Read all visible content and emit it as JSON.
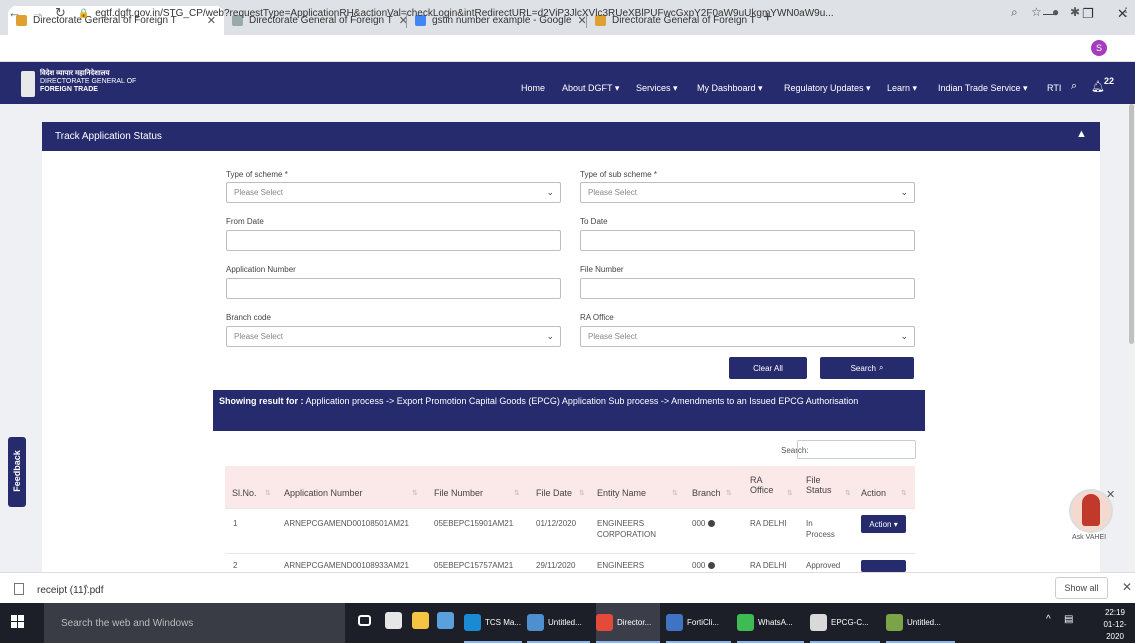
{
  "browser": {
    "tabs": [
      {
        "title": "Directorate General of Foreign T",
        "active": true
      },
      {
        "title": "Directorate General of Foreign T"
      },
      {
        "title": "gstin number example - Google"
      },
      {
        "title": "Directorate General of Foreign T"
      }
    ],
    "url": "egtf.dgft.gov.in/STG_CP/web?requestType=ApplicationRH&actionVal=checkLogin&intRedirectURL=d2ViP3JlcXVlc3RUeXBlPUFwcGxpY2F0aW9uUkgmYWN0aW9u...",
    "profile_initial": "S"
  },
  "site": {
    "logo_hindi": "विदेश व्यापार महानिदेशालय",
    "logo_line1": "DIRECTORATE GENERAL OF",
    "logo_line2": "FOREIGN TRADE",
    "nav": [
      "Home",
      "About DGFT ▾",
      "Services ▾",
      "My Dashboard ▾",
      "Regulatory Updates ▾",
      "Learn ▾",
      "Indian Trade Service ▾",
      "RTI"
    ],
    "notif_count": "22"
  },
  "panel": {
    "title": "Track Application Status",
    "type_of_scheme_label": "Type of scheme *",
    "type_of_scheme_value": "Please Select",
    "type_of_sub_scheme_label": "Type of sub scheme *",
    "type_of_sub_scheme_value": "Please Select",
    "from_date_label": "From Date",
    "to_date_label": "To Date",
    "application_number_label": "Application Number",
    "file_number_label": "File Number",
    "branch_code_label": "Branch code",
    "branch_code_value": "Please Select",
    "ra_office_label": "RA Office",
    "ra_office_value": "Please Select",
    "clear_all": "Clear All",
    "search": "Search"
  },
  "result": {
    "prefix": "Showing result for :",
    "text": " Application process -> Export Promotion Capital Goods (EPCG) Application Sub process -> Amendments to an Issued EPCG Authorisation",
    "search_label": "Search:"
  },
  "table": {
    "headers": {
      "slno": "Sl.No.",
      "appno": "Application Number",
      "fileno": "File Number",
      "filedate": "File Date",
      "entity": "Entity Name",
      "branch": "Branch",
      "raoffice_1": "RA",
      "raoffice_2": "Office",
      "status_1": "File",
      "status_2": "Status",
      "action": "Action"
    },
    "rows": [
      {
        "slno": "1",
        "appno": "ARNEPCGAMEND00108501AM21",
        "fileno": "05EBEPC15901AM21",
        "filedate": "01/12/2020",
        "entity1": "ENGINEERS",
        "entity2": "CORPORATION",
        "branch": "000",
        "raoffice": "RA DELHI",
        "status1": "In",
        "status2": "Process",
        "action": "Action ▾"
      },
      {
        "slno": "2",
        "appno": "ARNEPCGAMEND00108933AM21",
        "fileno": "05EBEPC15757AM21",
        "filedate": "29/11/2020",
        "entity1": "ENGINEERS",
        "branch": "000",
        "raoffice": "RA DELHI",
        "status1": "Approved"
      }
    ]
  },
  "widgets": {
    "feedback": "Feedback",
    "bot_label": "Ask VAHEI"
  },
  "downloads": {
    "file": "receipt (11).pdf",
    "show_all": "Show all"
  },
  "taskbar": {
    "search_placeholder": "Search the web and Windows",
    "apps": [
      "TCS Ma...",
      "Untitled...",
      "Director...",
      "FortiCli...",
      "WhatsA...",
      "EPCG-C...",
      "Untitled..."
    ],
    "time": "22:19",
    "date": "01-12-2020"
  }
}
